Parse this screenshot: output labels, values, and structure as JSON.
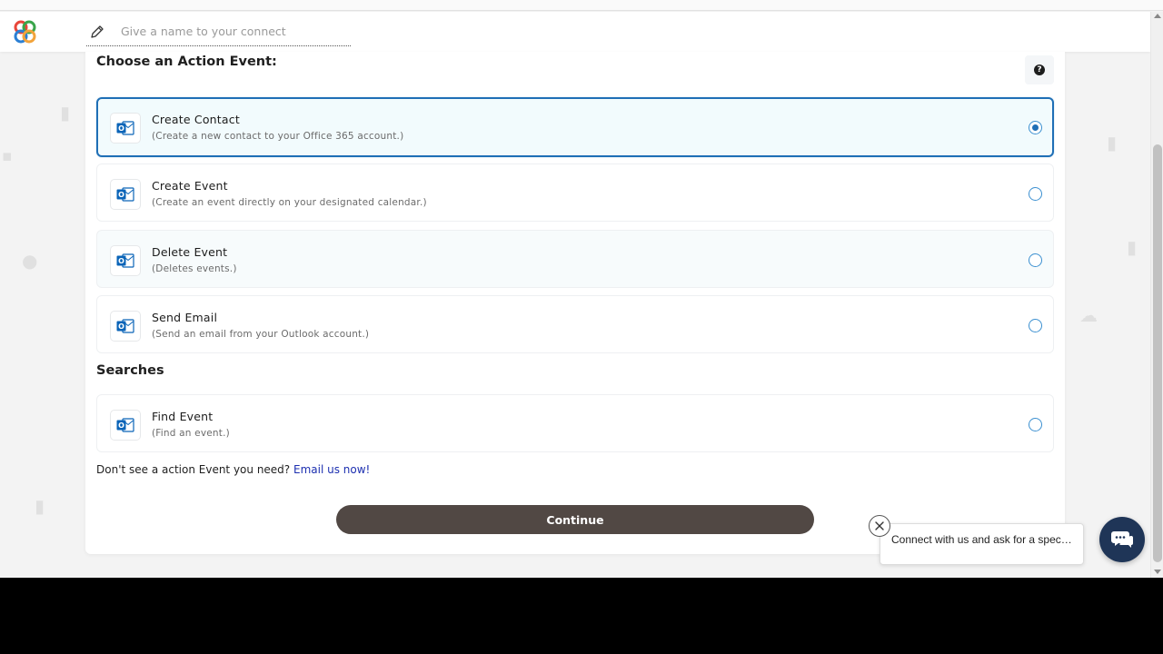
{
  "header": {
    "name_placeholder": "Give a name to your connect",
    "name_value": ""
  },
  "action_section": {
    "title": "Choose an Action Event:",
    "help_label": "?"
  },
  "actions": [
    {
      "title": "Create Contact",
      "description": "(Create a new contact to your Office 365 account.)",
      "selected": true,
      "icon": "outlook-icon"
    },
    {
      "title": "Create Event",
      "description": "(Create an event directly on your designated calendar.)",
      "selected": false,
      "icon": "outlook-icon"
    },
    {
      "title": "Delete Event",
      "description": "(Deletes events.)",
      "selected": false,
      "icon": "outlook-icon"
    },
    {
      "title": "Send Email",
      "description": "(Send an email from your Outlook account.)",
      "selected": false,
      "icon": "outlook-icon"
    }
  ],
  "searches_section": {
    "title": "Searches"
  },
  "searches": [
    {
      "title": "Find Event",
      "description": "(Find an event.)",
      "selected": false,
      "icon": "outlook-icon"
    }
  ],
  "footer": {
    "note": "Don't see a action Event you need?",
    "link": "Email us now!"
  },
  "continue_label": "Continue",
  "chat": {
    "message": "Connect with us and ask for a speci...",
    "close_icon": "close-icon",
    "fab_icon": "chat-icon"
  },
  "colors": {
    "selected_border": "#1f6fb6",
    "continue_button": "#514844",
    "link": "#1c2fb0",
    "chat_fab": "#1f3557"
  }
}
